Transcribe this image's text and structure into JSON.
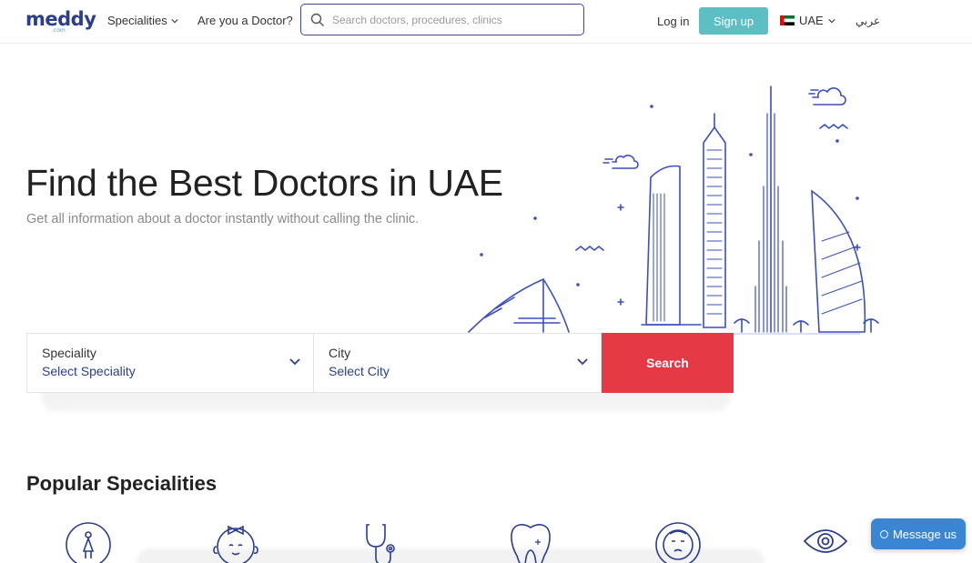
{
  "header": {
    "logo_text": "meddy",
    "logo_sub": ".com",
    "nav": {
      "specialities": "Specialities",
      "are_you_doctor": "Are you a Doctor?"
    },
    "search_placeholder": "Search doctors, procedures, clinics",
    "login": "Log in",
    "signup": "Sign up",
    "country": "UAE",
    "language": "عربي"
  },
  "hero": {
    "title": "Find the Best Doctors in UAE",
    "subtitle": "Get all information about a doctor instantly without calling the clinic."
  },
  "form": {
    "speciality_label": "Speciality",
    "speciality_value": "Select Speciality",
    "city_label": "City",
    "city_value": "Select City",
    "search_button": "Search"
  },
  "popular": {
    "title": "Popular Specialities",
    "icons": [
      "obstetrics-icon",
      "baby-icon",
      "stethoscope-icon",
      "tooth-icon",
      "face-icon",
      "eye-icon"
    ]
  },
  "message_button": "Message us",
  "colors": {
    "brand": "#2a3d8f",
    "teal": "#5bbfc4",
    "red": "#e63946",
    "chat": "#3a86d4"
  }
}
